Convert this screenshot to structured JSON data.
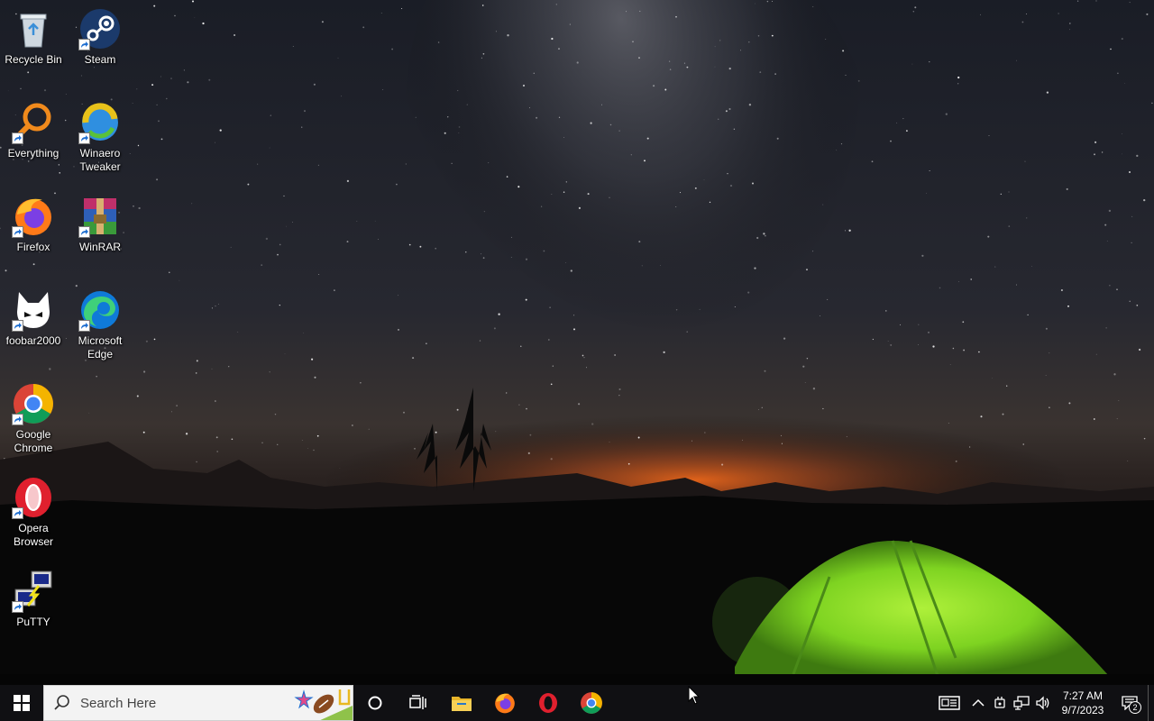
{
  "desktop": {
    "icons": [
      {
        "label": "Recycle Bin",
        "icon": "recycle-bin-icon"
      },
      {
        "label": "Steam",
        "icon": "steam-icon"
      },
      {
        "label": "Everything",
        "icon": "everything-search-icon"
      },
      {
        "label": "Winaero Tweaker",
        "icon": "winaero-tweaker-icon"
      },
      {
        "label": "Firefox",
        "icon": "firefox-icon"
      },
      {
        "label": "WinRAR",
        "icon": "winrar-icon"
      },
      {
        "label": "foobar2000",
        "icon": "foobar2000-icon"
      },
      {
        "label": "Microsoft Edge",
        "icon": "edge-icon"
      },
      {
        "label": "Google Chrome",
        "icon": "chrome-icon"
      },
      {
        "label": "Opera Browser",
        "icon": "opera-icon"
      },
      {
        "label": "PuTTY",
        "icon": "putty-icon"
      }
    ]
  },
  "taskbar": {
    "search_placeholder": "Search Here",
    "pinned": [
      "file-explorer-icon",
      "firefox-icon",
      "opera-icon",
      "chrome-icon"
    ],
    "clock": {
      "time": "7:27 AM",
      "date": "9/7/2023"
    },
    "notification_count": "2"
  },
  "colors": {
    "taskbar_bg": "#101013",
    "tent_green": "#7ed321",
    "horizon_orange": "#e8651a"
  }
}
